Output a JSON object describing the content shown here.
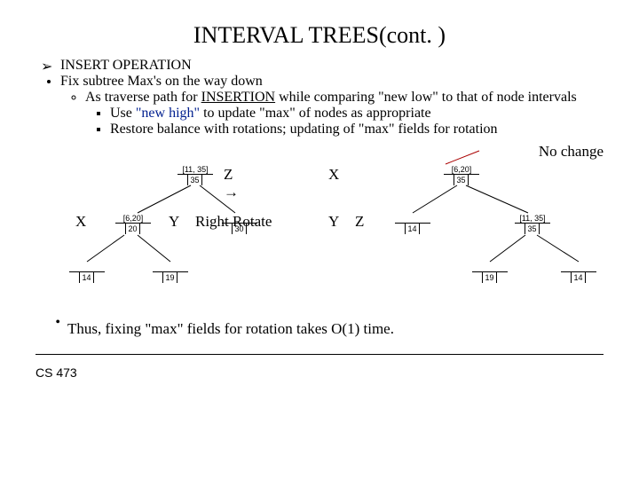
{
  "title": "INTERVAL TREES(cont. )",
  "bullets": {
    "head": "INSERT OPERATION",
    "b1": "Fix subtree Max's on the way down",
    "b1a_a": "As traverse path for ",
    "b1a_b": "INSERTION",
    "b1a_c": " while comparing \"new low\" to that of node intervals",
    "b1a1_a": "Use ",
    "b1a1_b": "\"new high\"",
    "b1a1_c": " to update \"max\" of nodes as appropriate",
    "b1a2": "Restore balance with rotations; updating of \"max\" fields for rotation"
  },
  "no_change": "No change",
  "labels": {
    "Z": "Z",
    "X": "X",
    "Y": "Y",
    "arrow": "→",
    "right_rotate": "Right Rotate"
  },
  "left_tree": {
    "root": {
      "int": "[11, 35]",
      "max": "35"
    },
    "y": {
      "int": "[6,20]",
      "max": "20"
    },
    "l14": {
      "int": "",
      "max": "14"
    },
    "l30": {
      "int": "",
      "max": "30"
    },
    "l19": {
      "int": "",
      "max": "19"
    }
  },
  "right_tree": {
    "root": {
      "int": "[6,20]",
      "max": "35"
    },
    "z": {
      "int": "[11, 35]",
      "max": "35"
    },
    "l14": {
      "int": "",
      "max": "14"
    },
    "l19": {
      "int": "",
      "max": "19"
    },
    "l14b": {
      "int": "",
      "max": "14"
    }
  },
  "conclusion": "Thus, fixing \"max\" fields for rotation takes O(1) time.",
  "footer": "CS 473"
}
